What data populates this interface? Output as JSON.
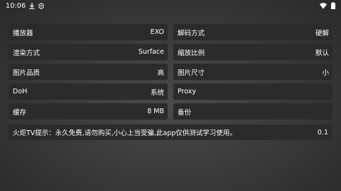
{
  "status": {
    "time": "10:06",
    "download_icon": "download-icon",
    "app_icon": "app-notification-icon",
    "wifi_icon": "wifi-icon",
    "battery_icon": "battery-icon"
  },
  "settings": [
    {
      "label": "播放器",
      "value": "EXO"
    },
    {
      "label": "解码方式",
      "value": "硬解"
    },
    {
      "label": "渲染方式",
      "value": "Surface"
    },
    {
      "label": "缩放比例",
      "value": "默认"
    },
    {
      "label": "图片品质",
      "value": "高"
    },
    {
      "label": "图片尺寸",
      "value": "小"
    },
    {
      "label": "DoH",
      "value": "系统"
    },
    {
      "label": "Proxy",
      "value": ""
    },
    {
      "label": "缓存",
      "value": "8 MB"
    },
    {
      "label": "备份",
      "value": ""
    }
  ],
  "footer": {
    "notice": "火炬TV提示：永久免费,请勿购买,小心上当受骗,此app仅供测试学习使用。",
    "version": "0.1"
  }
}
